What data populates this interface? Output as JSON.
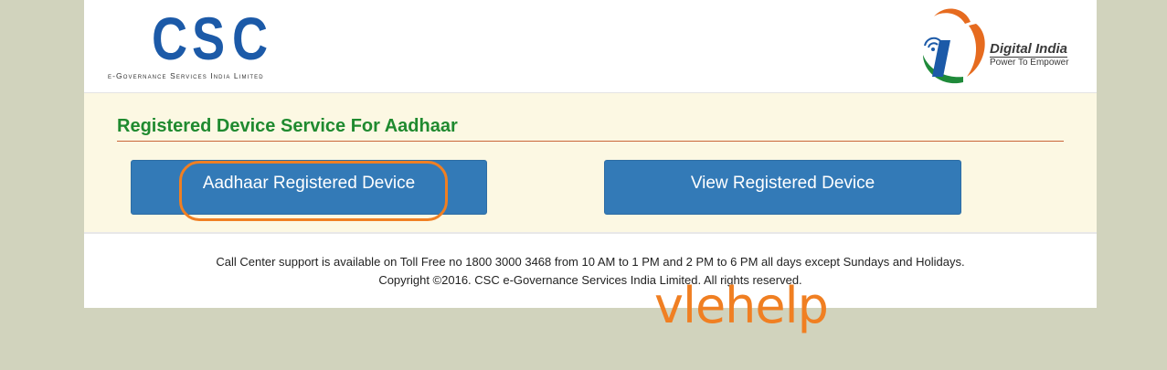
{
  "header": {
    "csc_logo": {
      "letters": [
        "C",
        "S",
        "C"
      ],
      "tagline": "e-Governance Services India Limited",
      "brand_color": "#1c5aa8"
    },
    "digital_india_logo": {
      "title": "Digital India",
      "subtitle": "Power To Empower",
      "colors": {
        "orange": "#e66b1f",
        "green": "#1f8a3a",
        "blue": "#1c5aa8"
      }
    }
  },
  "content": {
    "title": "Registered Device Service For Aadhaar",
    "title_color": "#1f8a2f",
    "buttons": {
      "aadhaar_registered_device": "Aadhaar Registered Device",
      "view_registered_device": "View Registered Device"
    },
    "button_color": "#337ab7",
    "highlight_color": "#f07f22"
  },
  "footer": {
    "support": "Call Center support is available on Toll Free no 1800 3000 3468 from 10 AM to 1 PM and 2 PM to 6 PM all days except Sundays and Holidays.",
    "copyright": "Copyright ©2016. CSC e-Governance Services India Limited. All rights reserved."
  },
  "watermark": {
    "text": "vlehelp",
    "color": "#f07f22"
  }
}
